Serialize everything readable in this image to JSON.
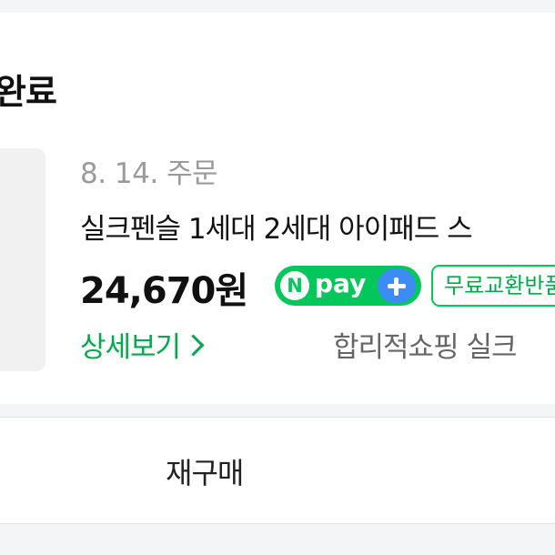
{
  "order": {
    "status_title": "완료",
    "date_text": "8. 14. 주문",
    "product_name": "실크펜슬 1세대 2세대 아이패드 스",
    "price": "24,670원",
    "npay_badge": {
      "n_text": "N",
      "text": "pay",
      "icon": "plus-icon"
    },
    "exchange_badge": "무료교환반품",
    "detail_link": "상세보기",
    "store_name": "합리적쇼핑 실크"
  },
  "actions": {
    "repurchase_label": "재구매"
  },
  "colors": {
    "naver_green": "#03c75a",
    "link_green": "#03a84d",
    "plus_blue": "#3d8bf5",
    "background": "#f4f5f7"
  }
}
